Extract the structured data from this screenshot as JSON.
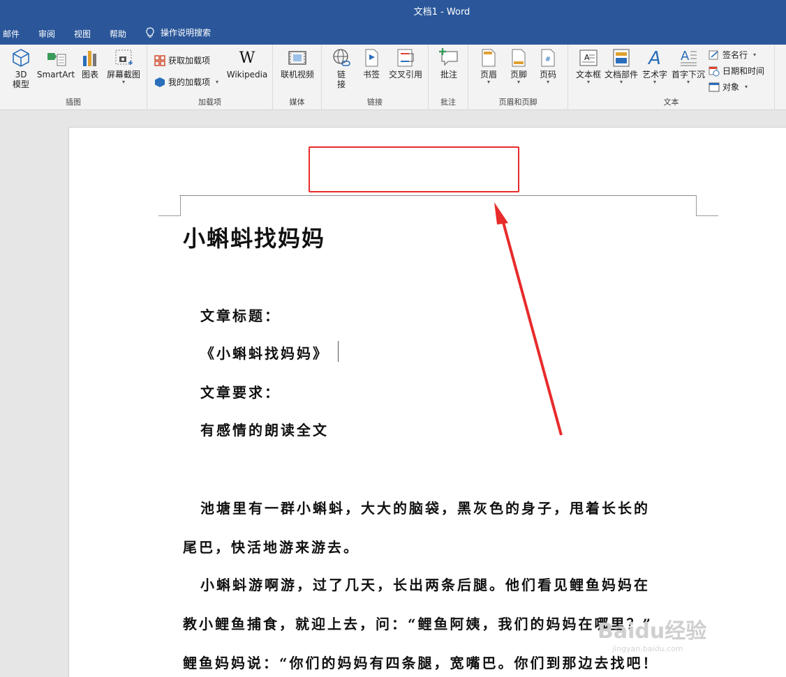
{
  "window": {
    "title": "文档1 - Word"
  },
  "tabs": {
    "items": [
      {
        "label": "邮件"
      },
      {
        "label": "审阅"
      },
      {
        "label": "视图"
      },
      {
        "label": "帮助"
      }
    ],
    "search_label": "操作说明搜索"
  },
  "ribbon": {
    "illustrations": {
      "label": "插图",
      "model3d": "3D\n模型",
      "model3d_line1": "3D",
      "model3d_line2": "模型",
      "smartart": "SmartArt",
      "chart": "图表",
      "screenshot": "屏幕截图"
    },
    "addins": {
      "label": "加载项",
      "get_addins": "获取加载项",
      "my_addins": "我的加载项",
      "wikipedia": "Wikipedia"
    },
    "media": {
      "label": "媒体",
      "online_video": "联机视频"
    },
    "links": {
      "label": "链接",
      "link_line1": "链",
      "link_line2": "接",
      "bookmark": "书签",
      "cross_ref": "交叉引用"
    },
    "comments": {
      "label": "批注",
      "comment": "批注"
    },
    "header_footer": {
      "label": "页眉和页脚",
      "header": "页眉",
      "footer": "页脚",
      "page_number": "页码"
    },
    "text": {
      "label": "文本",
      "textbox": "文本框",
      "quick_parts": "文档部件",
      "wordart": "艺术字",
      "drop_cap": "首字下沉",
      "signature": "签名行",
      "datetime": "日期和时间",
      "object": "对象"
    }
  },
  "document": {
    "title": "小蝌蚪找妈妈",
    "lines": [
      "文章标题：",
      "《小蝌蚪找妈妈》",
      "文章要求：",
      "有感情的朗读全文",
      "池塘里有一群小蝌蚪，大大的脑袋，黑灰色的身子，甩着长长的",
      "尾巴，快活地游来游去。",
      "小蝌蚪游啊游，过了几天，长出两条后腿。他们看见鲤鱼妈妈在",
      "教小鲤鱼捕食，就迎上去，问：“鲤鱼阿姨，我们的妈妈在哪里？”",
      "鲤鱼妈妈说：“你们的妈妈有四条腿，宽嘴巴。你们到那边去找吧！"
    ]
  },
  "watermark": {
    "text": "Baidu经验",
    "sub": "jingyan.baidu.com"
  },
  "colors": {
    "titlebar": "#2b579a",
    "highlight_red": "#e82b2b"
  }
}
